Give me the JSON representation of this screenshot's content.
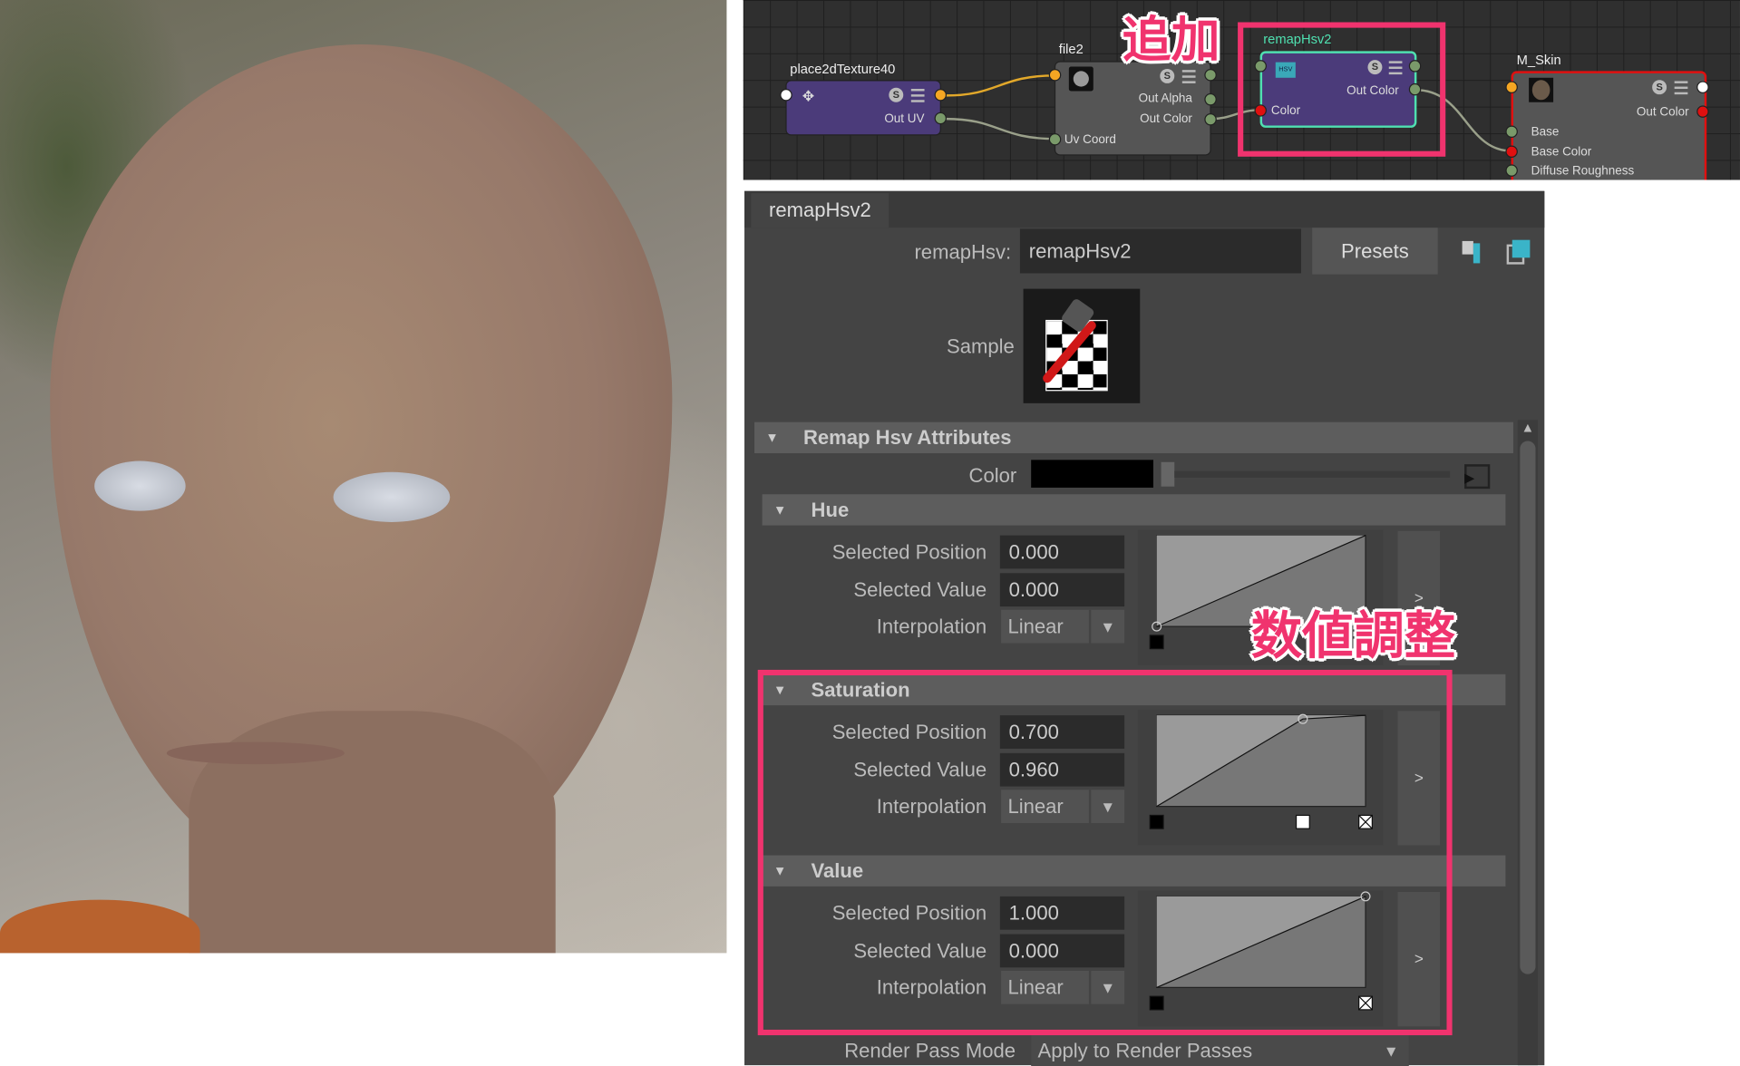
{
  "node_editor": {
    "nodes": [
      {
        "name": "place2dTexture40",
        "outputs": [
          "Out UV"
        ],
        "color": "#4b3b7a"
      },
      {
        "name": "file2",
        "outputs": [
          "Out Alpha",
          "Out Color"
        ],
        "inputs": [
          "Uv Coord"
        ],
        "color": "#555555"
      },
      {
        "name": "remapHsv2",
        "outputs": [
          "Out Color"
        ],
        "inputs": [
          "Color"
        ],
        "color": "#4b3b7a",
        "highlight": "#4fe0b0",
        "badge": "HSV"
      },
      {
        "name": "M_Skin",
        "outputs": [
          "Out Color"
        ],
        "inputs": [
          "Base",
          "Base Color",
          "Diffuse Roughness"
        ],
        "color": "#555555",
        "highlight": "#e01010"
      }
    ],
    "annotation": "追加"
  },
  "attribute_editor": {
    "tab": "remapHsv2",
    "node_type_label": "remapHsv:",
    "node_name": "remapHsv2",
    "presets_label": "Presets",
    "sample_label": "Sample",
    "section_title": "Remap Hsv Attributes",
    "color_label": "Color",
    "color_value": "#000000",
    "groups": [
      {
        "title": "Hue",
        "selected_position": "0.000",
        "selected_value": "0.000",
        "interpolation": "Linear",
        "curve": [
          [
            0,
            0
          ],
          [
            1,
            1
          ]
        ]
      },
      {
        "title": "Saturation",
        "selected_position": "0.700",
        "selected_value": "0.960",
        "interpolation": "Linear",
        "curve": [
          [
            0,
            0
          ],
          [
            0.7,
            0.96
          ],
          [
            1,
            1
          ]
        ]
      },
      {
        "title": "Value",
        "selected_position": "1.000",
        "selected_value": "0.000",
        "interpolation": "Linear",
        "curve": [
          [
            0,
            0
          ],
          [
            1,
            1
          ]
        ]
      }
    ],
    "labels": {
      "pos": "Selected Position",
      "val": "Selected Value",
      "interp": "Interpolation",
      "expand": ">"
    },
    "render_pass_label": "Render Pass Mode",
    "render_pass_value": "Apply to Render Passes",
    "annotation": "数値調整",
    "accent": "#f0336e"
  }
}
